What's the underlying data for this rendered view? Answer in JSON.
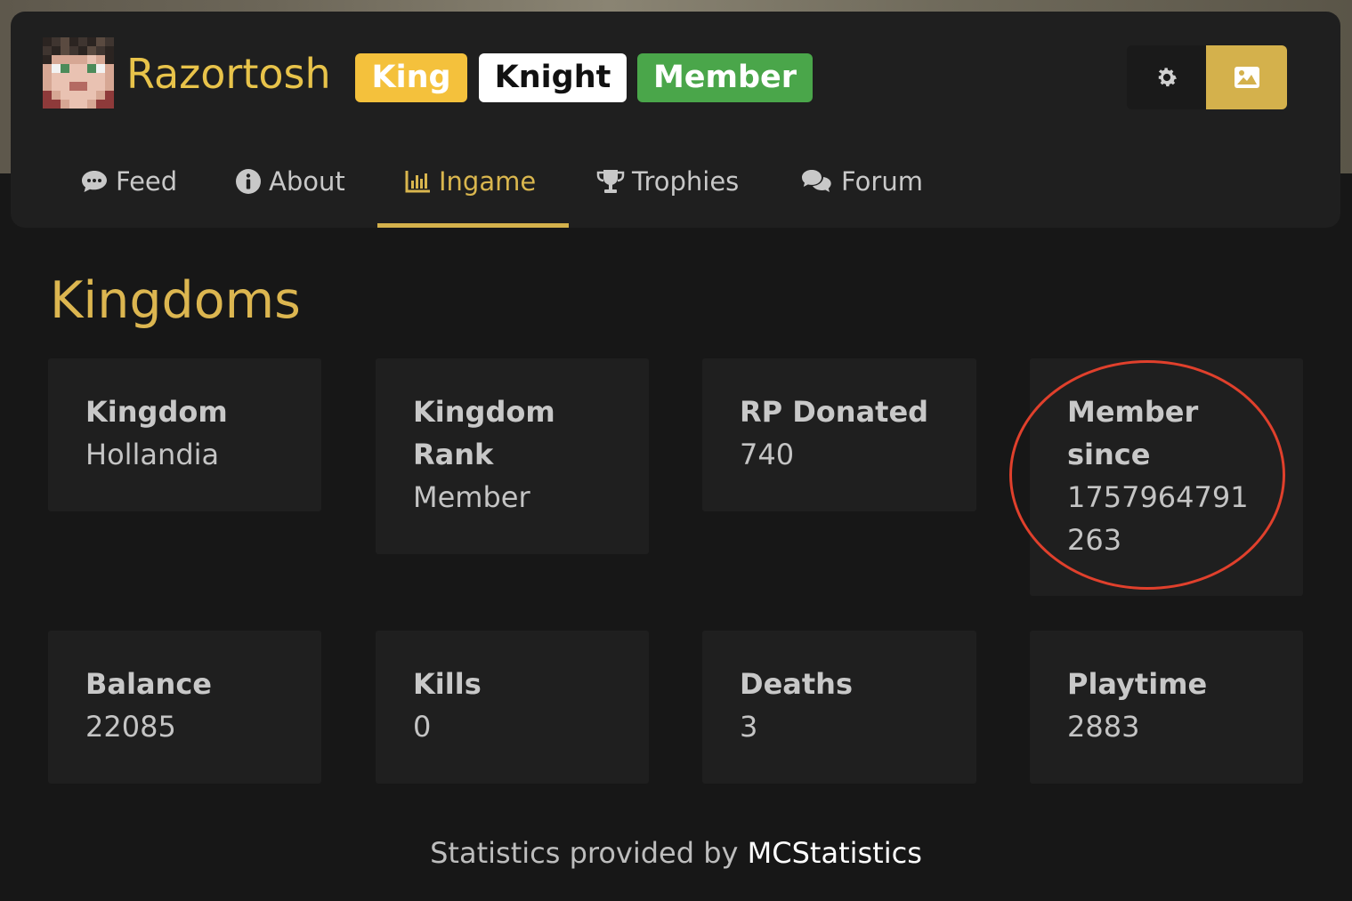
{
  "profile": {
    "username": "Razortosh",
    "badges": [
      "King",
      "Knight",
      "Member"
    ]
  },
  "header_buttons": {
    "settings_icon": "gear-icon",
    "image_icon": "image-icon",
    "image_button_color": "#d4b14c"
  },
  "tabs": [
    {
      "label": "Feed",
      "icon": "comment-dots-icon"
    },
    {
      "label": "About",
      "icon": "info-circle-icon"
    },
    {
      "label": "Ingame",
      "icon": "bar-chart-icon",
      "active": true
    },
    {
      "label": "Trophies",
      "icon": "trophy-icon"
    },
    {
      "label": "Forum",
      "icon": "comments-icon"
    }
  ],
  "section": {
    "title": "Kingdoms"
  },
  "stats": [
    {
      "label": "Kingdom",
      "value": "Hollandia"
    },
    {
      "label": "Kingdom Rank",
      "value": "Member"
    },
    {
      "label": "RP Donated",
      "value": "740"
    },
    {
      "label": "Member since",
      "value": "1757964791263"
    },
    {
      "label": "Balance",
      "value": "22085"
    },
    {
      "label": "Kills",
      "value": "0"
    },
    {
      "label": "Deaths",
      "value": "3"
    },
    {
      "label": "Playtime",
      "value": "2883"
    }
  ],
  "footer": {
    "prefix": "Statistics provided by ",
    "link": "MCStatistics"
  },
  "colors": {
    "accent": "#d4b14c",
    "username": "#e8c34a",
    "badge_king": "#f4c13c",
    "badge_knight": "#ffffff",
    "badge_member": "#4aa64a",
    "annotation_circle": "#e0402c"
  }
}
